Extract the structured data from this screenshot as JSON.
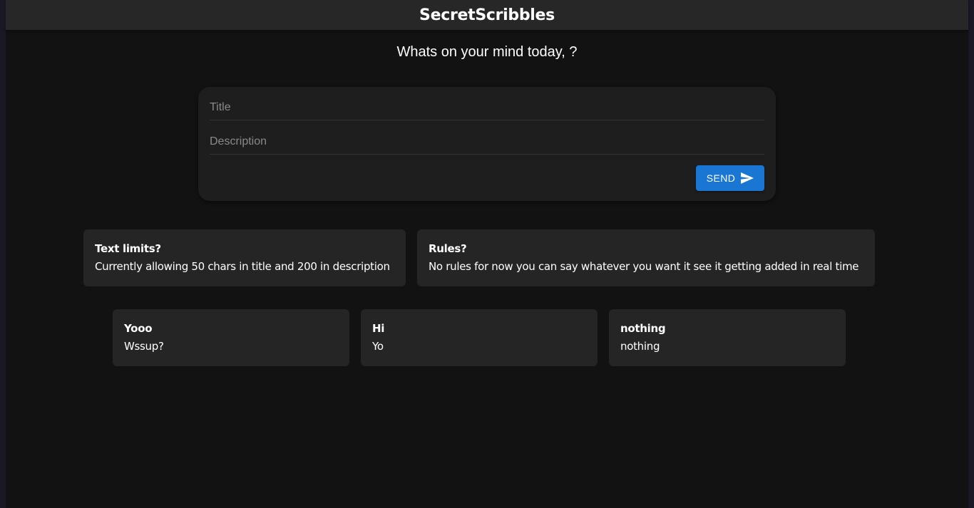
{
  "app": {
    "title": "SecretScribbles"
  },
  "greeting": "Whats on your mind today, ?",
  "form": {
    "title_placeholder": "Title",
    "description_placeholder": "Description",
    "send_label": "SEND",
    "send_icon": "send-icon"
  },
  "info_cards": [
    {
      "title": "Text limits?",
      "body": "Currently allowing 50 chars in title and 200 in description"
    },
    {
      "title": "Rules?",
      "body": "No rules for now you can say whatever you want it see it getting added in real time"
    }
  ],
  "posts": [
    {
      "title": "Yooo",
      "body": "Wssup?"
    },
    {
      "title": "Hi",
      "body": "Yo"
    },
    {
      "title": "nothing",
      "body": "nothing"
    }
  ],
  "colors": {
    "background": "#121212",
    "appbar": "#272727",
    "card": "#252525",
    "form_card": "#1e1e1e",
    "accent": "#1976d2"
  }
}
